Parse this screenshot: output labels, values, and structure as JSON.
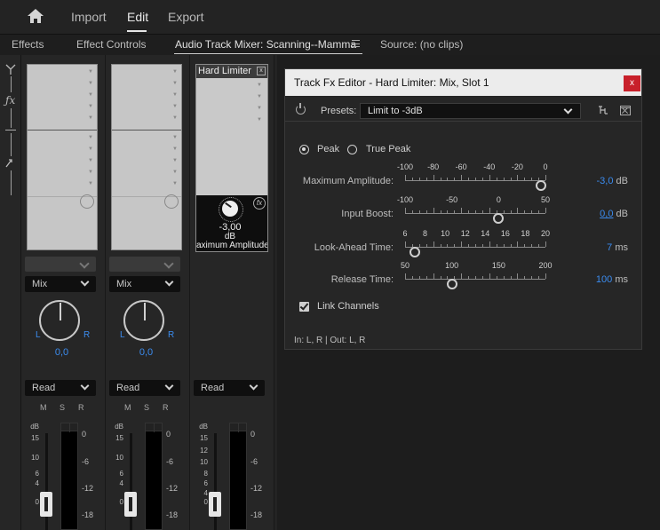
{
  "topnav": {
    "items": [
      "Import",
      "Edit",
      "Export"
    ],
    "active": "Edit"
  },
  "tabs": {
    "effects": "Effects",
    "effect_controls": "Effect Controls",
    "mixer": "Audio Track Mixer: Scanning--Mamma",
    "source": "Source: (no clips)"
  },
  "mixer": {
    "channels": [
      {
        "mode": "Mix",
        "pan_left": "L",
        "pan_right": "R",
        "pan_value": "0,0",
        "automation": "Read",
        "msr": [
          "M",
          "S",
          "R"
        ]
      },
      {
        "mode": "Mix",
        "pan_left": "L",
        "pan_right": "R",
        "pan_value": "0,0",
        "automation": "Read",
        "msr": [
          "M",
          "S",
          "R"
        ]
      },
      {
        "automation": "Read",
        "msr": [
          "M",
          "S",
          "R"
        ]
      }
    ],
    "fader_scale": {
      "unit": "dB",
      "labels": [
        "15",
        "10",
        "6",
        "4",
        "0"
      ]
    },
    "meter_scale": [
      "0",
      "-6",
      "-12",
      "-18"
    ],
    "hard_limiter": {
      "title": "Hard Limiter",
      "close": "x",
      "fx_badge": "fx",
      "value": "-3,00",
      "unit": "dB",
      "param_name": "aximum Amplitude"
    }
  },
  "dialog": {
    "title": "Track Fx Editor - Hard Limiter: Mix, Slot 1",
    "close": "x",
    "presets_label": "Presets:",
    "preset_value": "Limit to -3dB",
    "mode": {
      "peak": "Peak",
      "true_peak": "True Peak",
      "selected": "Peak"
    },
    "params": [
      {
        "label": "Maximum Amplitude:",
        "scale": [
          "-100",
          "-80",
          "-60",
          "-40",
          "-20",
          "0"
        ],
        "value": "-3,0",
        "unit": "dB",
        "fraction": 0.97
      },
      {
        "label": "Input Boost:",
        "scale": [
          "-100",
          "-50",
          "0",
          "50"
        ],
        "value": "0,0",
        "unit": "dB",
        "fraction": 0.667
      },
      {
        "label": "Look-Ahead Time:",
        "scale": [
          "6",
          "8",
          "10",
          "12",
          "14",
          "16",
          "18",
          "20"
        ],
        "value": "7",
        "unit": "ms",
        "fraction": 0.071
      },
      {
        "label": "Release Time:",
        "scale": [
          "50",
          "100",
          "150",
          "200"
        ],
        "value": "100",
        "unit": "ms",
        "fraction": 0.333
      }
    ],
    "link_channels": "Link Channels",
    "link_checked": true,
    "io": "In: L, R | Out: L, R"
  }
}
